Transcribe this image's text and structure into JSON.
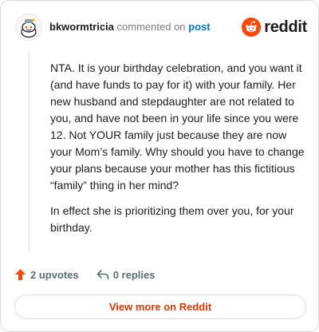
{
  "header": {
    "username": "bkwormtricia",
    "action_text": "commented on",
    "post_link": "post",
    "brand_name": "reddit"
  },
  "comment": {
    "paragraphs": [
      "NTA. It is your birthday celebration, and you want it (and have funds to pay for it) with your family. Her new husband and stepdaughter are not related to you, and have not been in your life since you were 12. Not YOUR family just because they are now your Mom’s family. Why should you have to change your plans because your mother has this fictitious “family” thing in her mind?",
      "In effect she is prioritizing them over you, for your birthday."
    ]
  },
  "footer": {
    "upvotes": "2 upvotes",
    "replies": "0 replies"
  },
  "view_more": {
    "label": "View more on Reddit"
  },
  "colors": {
    "brand_orange": "#ff4500",
    "link_blue": "#0079d3",
    "cta_red": "#d93a00",
    "meta_gray": "#576f76"
  },
  "icons": {
    "avatar": "reddit-snoo-avatar",
    "logo": "reddit-logo",
    "upvote": "upvote-arrow",
    "reply": "reply-arrow"
  }
}
